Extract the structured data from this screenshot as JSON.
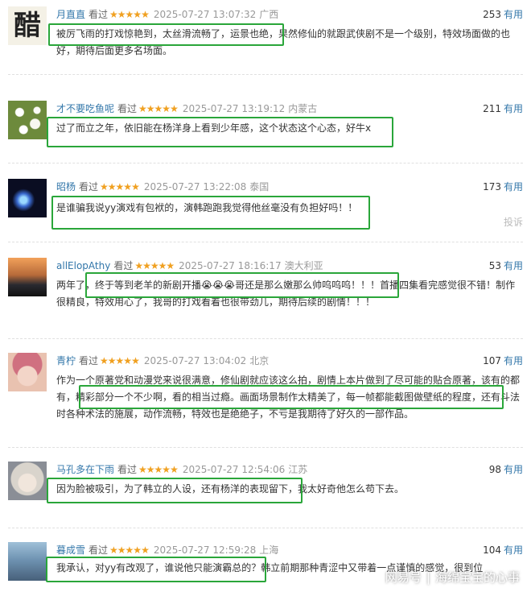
{
  "reviews": [
    {
      "user": "月直直",
      "status": "看过",
      "stars": "★★★★★",
      "time": "2025-07-27 13:07:32",
      "location": "广西",
      "votes": "253",
      "votes_label": "有用",
      "text": "被厉飞雨的打戏惊艳到，太丝滑流畅了，运景也绝，果然修仙的就跟武侠剧不是一个级别，特效场面做的也好，期待后面更多名场面。",
      "avatar_text": "醋"
    },
    {
      "user": "才不要吃鱼呢",
      "status": "看过",
      "stars": "★★★★★",
      "time": "2025-07-27 13:19:12",
      "location": "内蒙古",
      "votes": "211",
      "votes_label": "有用",
      "text": "过了而立之年，依旧能在杨洋身上看到少年感，这个状态这个心态，好牛x"
    },
    {
      "user": "昭杨",
      "status": "看过",
      "stars": "★★★★★",
      "time": "2025-07-27 13:22:08",
      "location": "泰国",
      "votes": "173",
      "votes_label": "有用",
      "text": "是谁骗我说yy演戏有包袱的，演韩跑跑我觉得他丝毫没有负担好吗！！",
      "report": "投诉"
    },
    {
      "user": "allElopAthy",
      "status": "看过",
      "stars": "★★★★★",
      "time": "2025-07-27 18:16:17",
      "location": "澳大利亚",
      "votes": "53",
      "votes_label": "有用",
      "text": "两年了，终于等到老羊的新剧开播😭😭😭哥还是那么嫩那么帅呜呜呜！！！首播四集看完感觉很不错！制作很精良，特效用心了，我哥的打戏看着也很带劲儿，期待后续的剧情！！！"
    },
    {
      "user": "青柠",
      "status": "看过",
      "stars": "★★★★★",
      "time": "2025-07-27 13:04:02",
      "location": "北京",
      "votes": "107",
      "votes_label": "有用",
      "text": "作为一个原著党和动漫党来说很满意，修仙剧就应该这么拍，剧情上本片做到了尽可能的贴合原著，该有的都有，精彩部分一个不少啊，看的相当过瘾。画面场景制作太精美了，每一帧都能截图做壁纸的程度，还有斗法时各种术法的施展，动作流畅，特效也是绝绝子，不亏是我期待了好久的一部作品。"
    },
    {
      "user": "马孔多在下雨",
      "status": "看过",
      "stars": "★★★★★",
      "time": "2025-07-27 12:54:06",
      "location": "江苏",
      "votes": "98",
      "votes_label": "有用",
      "text": "因为脸被吸引，为了韩立的人设，还有杨洋的表现留下，我太好奇他怎么苟下去。"
    },
    {
      "user": "暮成雪",
      "status": "看过",
      "stars": "★★★★★",
      "time": "2025-07-27 12:59:28",
      "location": "上海",
      "votes": "104",
      "votes_label": "有用",
      "text": "我承认，对yy有改观了，谁说他只能演霸总的？韩立前期那种青涩中又带着一点谨慎的感觉，很到位"
    }
  ],
  "watermark": {
    "source": "网易号",
    "separator": "|",
    "author": "海绵宝宝的心事"
  },
  "colors": {
    "username": "#3377aa",
    "star": "#f0a020",
    "highlight_border": "#2aa63a"
  }
}
